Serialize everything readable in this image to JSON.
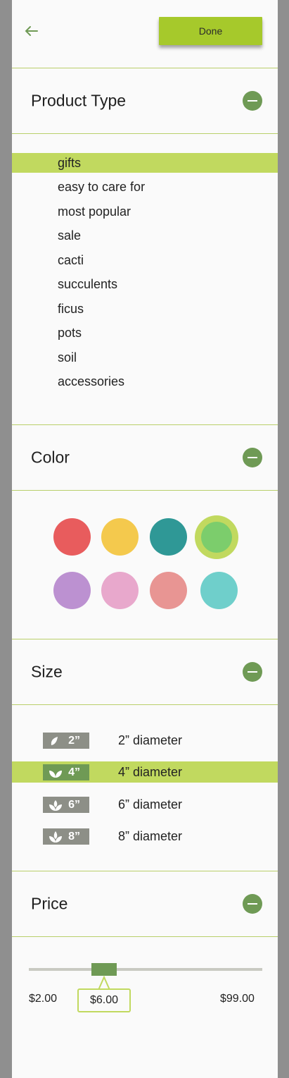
{
  "toolbar": {
    "back_icon": "arrow-left-icon",
    "done_label": "Done"
  },
  "sections": {
    "product_type": {
      "title": "Product Type",
      "items": [
        "gifts",
        "easy to care for",
        "most popular",
        "sale",
        "cacti",
        "succulents",
        "ficus",
        "pots",
        "soil",
        "accessories"
      ],
      "selected": "gifts"
    },
    "color": {
      "title": "Color",
      "swatches": [
        "#e85c5d",
        "#f4c94d",
        "#2f9896",
        "#7ccd6c",
        "#bc91d1",
        "#e8a8cc",
        "#e89593",
        "#6fcfcb"
      ],
      "selected_swatch": "#7ccd6c"
    },
    "size": {
      "title": "Size",
      "options": [
        {
          "badge": "2”",
          "label": "2” diameter"
        },
        {
          "badge": "4”",
          "label": "4” diameter"
        },
        {
          "badge": "6”",
          "label": "6” diameter"
        },
        {
          "badge": "8”",
          "label": "8” diameter"
        }
      ],
      "selected": "4” diameter"
    },
    "price": {
      "title": "Price",
      "min_label": "$2.00",
      "max_label": "$99.00",
      "current_label": "$6.00",
      "current_value": 6.0,
      "min_value": 2.0,
      "max_value": 99.0
    }
  },
  "colors": {
    "accent": "#a6c92b",
    "highlight": "#c1d95f",
    "icon_green": "#6f9a55"
  }
}
